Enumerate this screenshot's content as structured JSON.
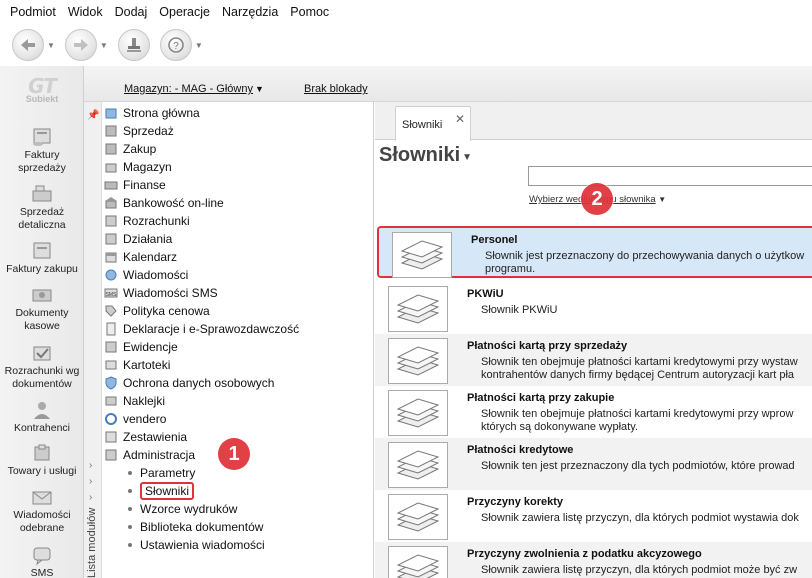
{
  "menu": [
    "Podmiot",
    "Widok",
    "Dodaj",
    "Operacje",
    "Narzędzia",
    "Pomoc"
  ],
  "band": {
    "magazyn": "Magazyn: - MAG - Główny",
    "blokada": "Brak blokady"
  },
  "logo": {
    "mark": "GT",
    "name": "Subiekt"
  },
  "modules": [
    "Faktury sprzedaży",
    "Sprzedaż detaliczna",
    "Faktury zakupu",
    "Dokumenty kasowe",
    "Rozrachunki wg dokumentów",
    "Kontrahenci",
    "Towary i usługi",
    "Wiadomości odebrane",
    "SMS"
  ],
  "tree": {
    "vertical_label": "Lista modułów",
    "items": [
      "Strona główna",
      "Sprzedaż",
      "Zakup",
      "Magazyn",
      "Finanse",
      "Bankowość on-line",
      "Rozrachunki",
      "Działania",
      "Kalendarz",
      "Wiadomości",
      "Wiadomości SMS",
      "Polityka cenowa",
      "Deklaracje i e-Sprawozdawczość",
      "Ewidencje",
      "Kartoteki",
      "Ochrona danych osobowych",
      "Naklejki",
      "vendero",
      "Zestawienia",
      "Administracja"
    ],
    "sub_items": [
      "Parametry",
      "Słowniki",
      "Wzorce wydruków",
      "Biblioteka dokumentów",
      "Ustawienia wiadomości"
    ],
    "selected_sub_item": "Słowniki"
  },
  "content": {
    "tab_label": "Słowniki",
    "title": "Słowniki",
    "search_value": "",
    "choose_label": "Wybierz według typu słownika",
    "dictionaries": [
      {
        "title": "Personel",
        "desc1": "Słownik jest przeznaczony do przechowywania danych o użytkow",
        "desc2": "programu."
      },
      {
        "title": "PKWiU",
        "desc1": "Słownik PKWiU",
        "desc2": ""
      },
      {
        "title": "Płatności kartą przy sprzedaży",
        "desc1": "Słownik ten obejmuje płatności kartami kredytowymi przy wystaw",
        "desc2": "kontrahentów danych firmy będącej Centrum autoryzacji kart pła"
      },
      {
        "title": "Płatności kartą przy zakupie",
        "desc1": "Słownik ten obejmuje płatności kartami kredytowymi przy wprow",
        "desc2": "których są dokonywane wypłaty."
      },
      {
        "title": "Płatności kredytowe",
        "desc1": "Słownik ten jest przeznaczony dla tych podmiotów, które prowad",
        "desc2": ""
      },
      {
        "title": "Przyczyny korekty",
        "desc1": "Słownik zawiera listę przyczyn, dla których podmiot wystawia dok",
        "desc2": ""
      },
      {
        "title": "Przyczyny zwolnienia z podatku akcyzowego",
        "desc1": "Słownik zawiera listę przyczyn, dla których podmiot może być zw",
        "desc2": ""
      }
    ]
  },
  "badges": {
    "one": "1",
    "two": "2"
  },
  "colors": {
    "highlight": "#e0323a",
    "selected_row": "#d6e7f7"
  }
}
